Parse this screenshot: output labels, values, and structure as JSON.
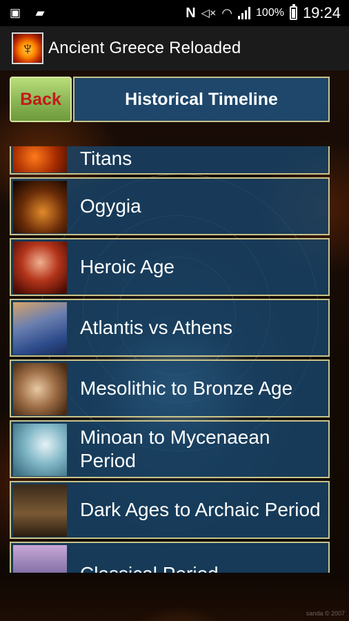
{
  "status_bar": {
    "battery_percent": "100%",
    "time": "19:24",
    "icons": [
      "image-icon",
      "briefcase-icon",
      "nfc-icon",
      "mute-icon",
      "wifi-icon",
      "signal-icon",
      "battery-icon"
    ]
  },
  "app_bar": {
    "title": "Ancient Greece Reloaded",
    "logo_icon": "phoenix-icon"
  },
  "header": {
    "back_label": "Back",
    "title": "Historical Timeline",
    "colors": {
      "back_text": "#c21a1a",
      "back_bg": "#8bb555",
      "title_bg": "#1e4c74",
      "border": "#c9c48a"
    }
  },
  "timeline_items": [
    {
      "label": "Titans",
      "thumb": "titans-thumbnail"
    },
    {
      "label": "Ogygia",
      "thumb": "ogygia-thumbnail"
    },
    {
      "label": "Heroic Age",
      "thumb": "heroic-age-thumbnail"
    },
    {
      "label": "Atlantis vs Athens",
      "thumb": "atlantis-thumbnail"
    },
    {
      "label": "Mesolithic to Bronze Age",
      "thumb": "mesolithic-thumbnail"
    },
    {
      "label": "Minoan to Mycenaean Period",
      "thumb": "minoan-thumbnail"
    },
    {
      "label": "Dark Ages to Archaic Period",
      "thumb": "dark-ages-thumbnail"
    },
    {
      "label": "Classical Period",
      "thumb": "classical-thumbnail"
    }
  ],
  "watermark": "sanda © 2007"
}
